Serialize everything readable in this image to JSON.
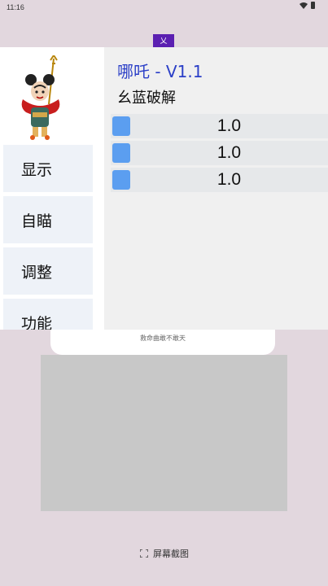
{
  "status_bar": {
    "time": "11:16"
  },
  "app_icon_glyph": "乂",
  "menu": {
    "nav_items": [
      {
        "label": "显示"
      },
      {
        "label": "自瞄"
      },
      {
        "label": "调整"
      },
      {
        "label": "功能"
      }
    ],
    "title": "哪吒 - V1.1",
    "subtitle": "幺蓝破解",
    "sliders": [
      {
        "value_text": "1.0",
        "value": 1.0
      },
      {
        "value_text": "1.0",
        "value": 1.0
      },
      {
        "value_text": "1.0",
        "value": 1.0
      }
    ],
    "colors": {
      "title": "#2b3fc7",
      "slider_handle": "#5b9ef0",
      "nav_bg": "#eef2f8"
    }
  },
  "background": {
    "dialog_text": "救命曲敢不敢天",
    "screenshot_label": "屏幕截图"
  }
}
